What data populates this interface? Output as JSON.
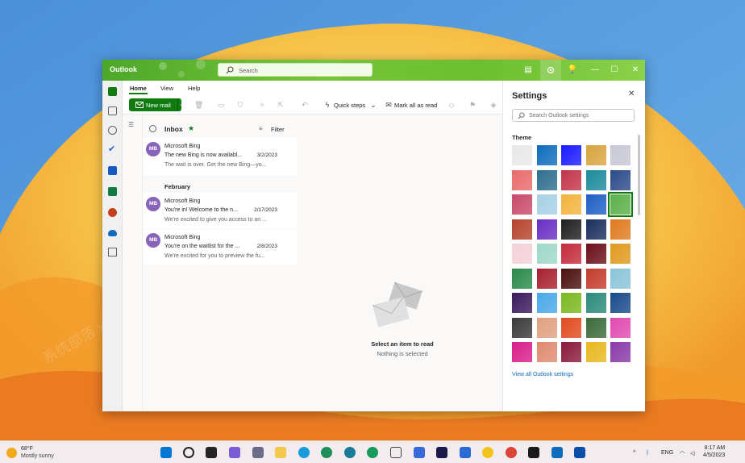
{
  "window": {
    "app_name": "Outlook",
    "search_placeholder": "Search"
  },
  "ribbon": {
    "tabs": [
      "Home",
      "View",
      "Help"
    ],
    "new_mail": "New mail",
    "quick_steps": "Quick steps",
    "mark_all_read": "Mark all as read"
  },
  "mail_list": {
    "folder": "Inbox",
    "filter": "Filter",
    "group_label": "February",
    "messages": [
      {
        "initials": "MB",
        "sender": "Microsoft Bing",
        "subject": "The new Bing is now availabl...",
        "date": "3/2/2023",
        "preview": "The wait is over. Get the new Bing—yo..."
      },
      {
        "initials": "MB",
        "sender": "Microsoft Bing",
        "subject": "You're in! Welcome to the n...",
        "date": "2/17/2023",
        "preview": "We're excited to give you access to an ..."
      },
      {
        "initials": "MB",
        "sender": "Microsoft Bing",
        "subject": "You're on the waitlist for the ...",
        "date": "2/8/2023",
        "preview": "We're excited for you to preview the fu..."
      }
    ]
  },
  "reading_pane": {
    "title": "Select an item to read",
    "subtitle": "Nothing is selected"
  },
  "settings": {
    "title": "Settings",
    "search_placeholder": "Search Outlook settings",
    "theme_label": "Theme",
    "view_all": "View all Outlook settings",
    "selected_theme_index": 14,
    "themes": [
      "#e8e8e8",
      "#0f6cbd",
      "#1a1aff",
      "#d9a441",
      "#c7c7d6",
      "#e86b6b",
      "#2e6e8e",
      "#c2344a",
      "#1b8a9a",
      "#2b4a8a",
      "#c94a6a",
      "#a8d0e6",
      "#f2b33d",
      "#1f5fc4",
      "#5cb04a",
      "#b5442c",
      "#6a2ec4",
      "#1f1f1f",
      "#1a2e5e",
      "#e07a1f",
      "#f5d0d8",
      "#9fd8c8",
      "#c42b3a",
      "#6b0f1a",
      "#e09a1f",
      "#2a8a4a",
      "#a81f2e",
      "#4a0f0f",
      "#c43a2a",
      "#8ac4d8",
      "#3a1a5e",
      "#4aa8e8",
      "#7ab81f",
      "#2a8a7a",
      "#1a4a8a",
      "#3a3a3a",
      "#e0a080",
      "#e04a1f",
      "#3a6a3a",
      "#e04ab0",
      "#d81f8a",
      "#e08a70",
      "#8a1a3a",
      "#e8b81f",
      "#8a3aa8"
    ]
  },
  "taskbar": {
    "weather_temp": "68°F",
    "weather_desc": "Mostly sunny",
    "lang": "ENG",
    "time": "8:17 AM",
    "date": "4/5/2023"
  },
  "watermark_text": "系统部落 xitongbuluo.com"
}
